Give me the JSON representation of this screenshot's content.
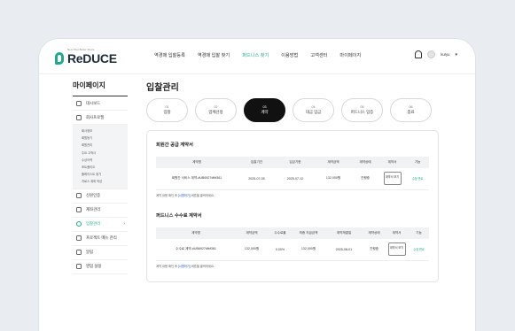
{
  "brand": {
    "sub": "Next Plus Better Share",
    "name": "ReDUCE"
  },
  "nav": {
    "items": [
      "역경매 입찰등록",
      "역경매 입찰 찾기",
      "퍼드니스 찾기",
      "이용방법",
      "고객센터",
      "마이페이지"
    ],
    "active_index": 2
  },
  "user": {
    "name": "kuryu"
  },
  "sidebar": {
    "title": "마이페이지",
    "items_top": [
      {
        "label": "대시보드",
        "icon": "home-icon"
      },
      {
        "label": "회사프로필",
        "icon": "doc-icon"
      }
    ],
    "sub_items": [
      "회사정보",
      "회원등기",
      "회원관리",
      "주요 고객사",
      "수상이력",
      "포트폴리오",
      "플레이스트 찾기",
      "치료스 계획 작성"
    ],
    "items_bottom": [
      {
        "label": "신원인증",
        "icon": "shield-icon"
      },
      {
        "label": "계좌관리",
        "icon": "bank-icon"
      },
      {
        "label": "입찰관리",
        "icon": "bid-icon",
        "active": true
      },
      {
        "label": "프로젝트 메뉴 관리",
        "icon": "menu-icon"
      },
      {
        "label": "알림",
        "icon": "bell-icon"
      },
      {
        "label": "영업 설정",
        "icon": "gear-icon"
      }
    ]
  },
  "page": {
    "title": "입찰관리"
  },
  "steps": [
    {
      "num": "01",
      "label": "입찰"
    },
    {
      "num": "02",
      "label": "업체선정"
    },
    {
      "num": "03",
      "label": "계약",
      "active": true
    },
    {
      "num": "04",
      "label": "대금 입금"
    },
    {
      "num": "05",
      "label": "퍼드니스 입증"
    },
    {
      "num": "06",
      "label": "종료"
    }
  ],
  "supply": {
    "title": "회원간 공급 계약서",
    "columns": [
      "계약명",
      "입찰기간",
      "입금기한",
      "계약금액",
      "계약상태",
      "계약서",
      "기능"
    ],
    "row": [
      "회원간 서비스 계약-#UB6927dfbf361",
      "2025-07-05",
      "2025-07-12",
      "132,000원",
      "진행중",
      "계약서 보기",
      "수정 변로"
    ],
    "note_pre": "계약 내용 확인 후 ",
    "note_link": "[서명하기]",
    "note_post": " 버튼을 클릭하세요."
  },
  "fee": {
    "title": "퍼드니스 수수료 계약서",
    "columns": [
      "계약명",
      "계약금액",
      "수수료율",
      "최종 지급금액",
      "계약체결일",
      "계약상태",
      "계약서",
      "기능"
    ],
    "row": [
      "수수료 계약-#UB6927dfbf361",
      "132,000원",
      "0.00%",
      "132,000원",
      "2025-08-01",
      "진행중",
      "계약서 보기",
      "수정 변로"
    ],
    "note_pre": "계약 내용 확인 후 ",
    "note_link": "[서명하기]",
    "note_post": " 버튼을 클릭하세요."
  },
  "colors": {
    "accent": "#1fa88a",
    "dark": "#111111",
    "link": "#1a4fd8"
  }
}
